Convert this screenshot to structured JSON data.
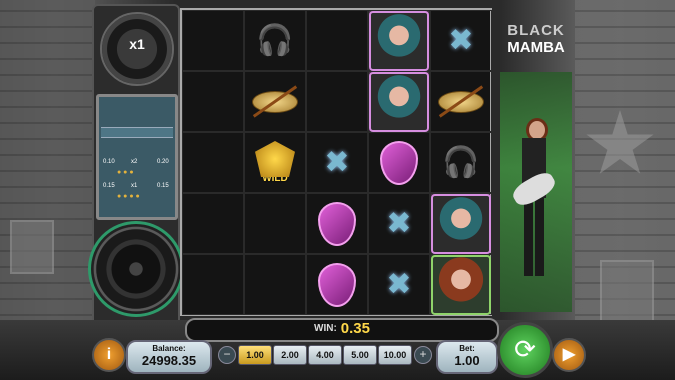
{
  "game": {
    "logo_line1": "BLACK",
    "logo_line2": "MAMBA"
  },
  "multiplier": "x1",
  "paytable": {
    "rows": [
      {
        "left": "0.10",
        "mid": "x2",
        "right": "0.20"
      },
      {
        "left": "0.15",
        "mid": "x1",
        "right": "0.15"
      }
    ]
  },
  "reels": [
    [
      "empty",
      "empty",
      "empty",
      "empty",
      "empty"
    ],
    [
      "headphones",
      "cymbal",
      "wild",
      "empty",
      "empty"
    ],
    [
      "empty",
      "empty",
      "microphone",
      "pick",
      "pick"
    ],
    [
      "singer",
      "singer",
      "pick",
      "microphone",
      "microphone"
    ],
    [
      "microphone",
      "cymbal",
      "headphones",
      "singer",
      "redhead"
    ]
  ],
  "wild_label": "WILD",
  "win": {
    "label": "WIN:",
    "amount": "0.35"
  },
  "balance": {
    "label": "Balance:",
    "value": "24998.35"
  },
  "bet_options": [
    "1.00",
    "2.00",
    "4.00",
    "5.00",
    "10.00"
  ],
  "bet_selected": "1.00",
  "bet": {
    "label": "Bet:",
    "value": "1.00"
  },
  "icons": {
    "info": "info-icon",
    "spin": "spin-arrows-icon",
    "autoplay": "autoplay-icon",
    "minus": "minus-icon",
    "plus": "plus-icon"
  }
}
